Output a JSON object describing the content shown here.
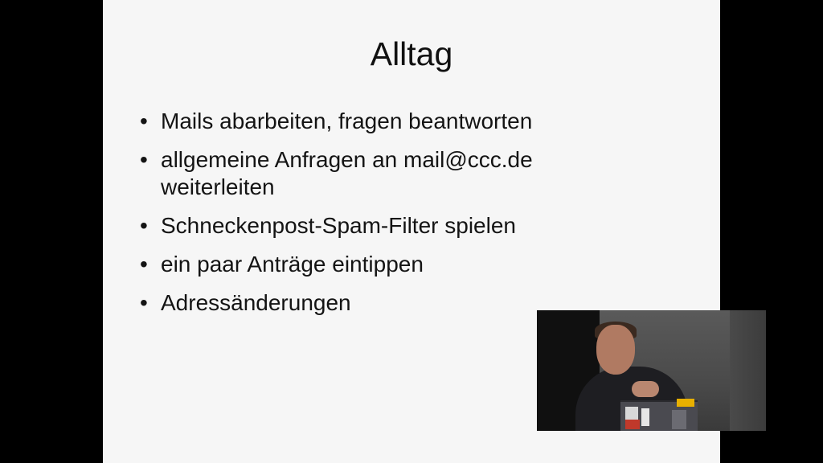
{
  "slide": {
    "title": "Alltag",
    "bullet_symbol": "•",
    "bullets": [
      "Mails abarbeiten, fragen beantworten",
      "allgemeine Anfragen an mail@ccc.de weiterleiten",
      "Schneckenpost-Spam-Filter spielen",
      "ein paar Anträge eintippen",
      "Adressänderungen"
    ]
  },
  "colors": {
    "slide_background": "#f6f6f6",
    "letterbox": "#000000",
    "text": "#141414"
  }
}
